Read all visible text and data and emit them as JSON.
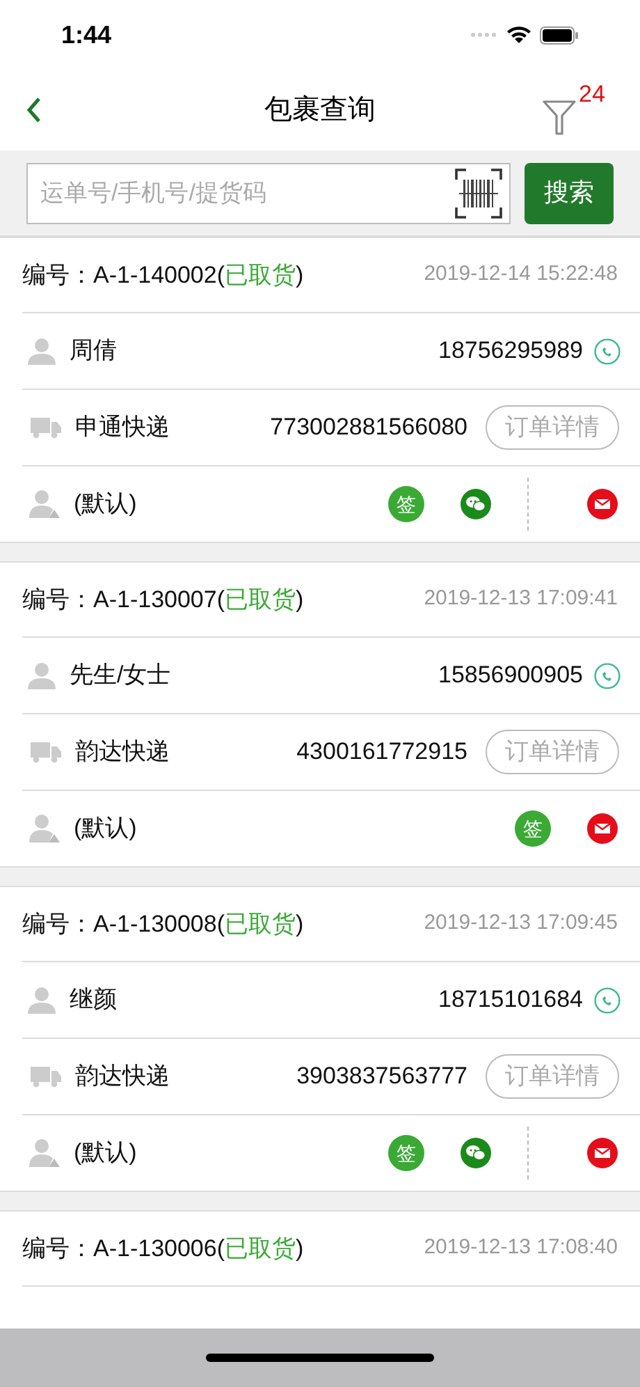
{
  "status_bar": {
    "time": "1:44"
  },
  "nav": {
    "title": "包裹查询",
    "filter_badge": "24"
  },
  "search": {
    "placeholder": "运单号/手机号/提货码",
    "button": "搜索"
  },
  "orders": [
    {
      "number": "编号：A-1-140002(",
      "status": "已取货",
      "close": ")",
      "time": "2019-12-14 15:22:48",
      "recipient": "周倩",
      "phone": "18756295989",
      "courier": "申通快递",
      "tracking": "773002881566080",
      "detail_button": "订单详情",
      "operator": "(默认)",
      "actions": [
        {
          "kind": "sign",
          "label": "签"
        },
        {
          "kind": "wechat"
        },
        {
          "kind": "mail"
        }
      ]
    },
    {
      "number": "编号：A-1-130007(",
      "status": "已取货",
      "close": ")",
      "time": "2019-12-13 17:09:41",
      "recipient": "先生/女士",
      "phone": "15856900905",
      "courier": "韵达快递",
      "tracking": "4300161772915",
      "detail_button": "订单详情",
      "operator": "(默认)",
      "actions": [
        {
          "kind": "sign",
          "label": "签"
        },
        {
          "kind": "mail"
        }
      ]
    },
    {
      "number": "编号：A-1-130008(",
      "status": "已取货",
      "close": ")",
      "time": "2019-12-13 17:09:45",
      "recipient": "继颜",
      "phone": "18715101684",
      "courier": "韵达快递",
      "tracking": "3903837563777",
      "detail_button": "订单详情",
      "operator": "(默认)",
      "actions": [
        {
          "kind": "sign",
          "label": "签"
        },
        {
          "kind": "wechat"
        },
        {
          "kind": "mail"
        }
      ]
    },
    {
      "number": "编号：A-1-130006(",
      "status": "已取货",
      "close": ")",
      "time": "2019-12-13 17:08:40"
    }
  ]
}
